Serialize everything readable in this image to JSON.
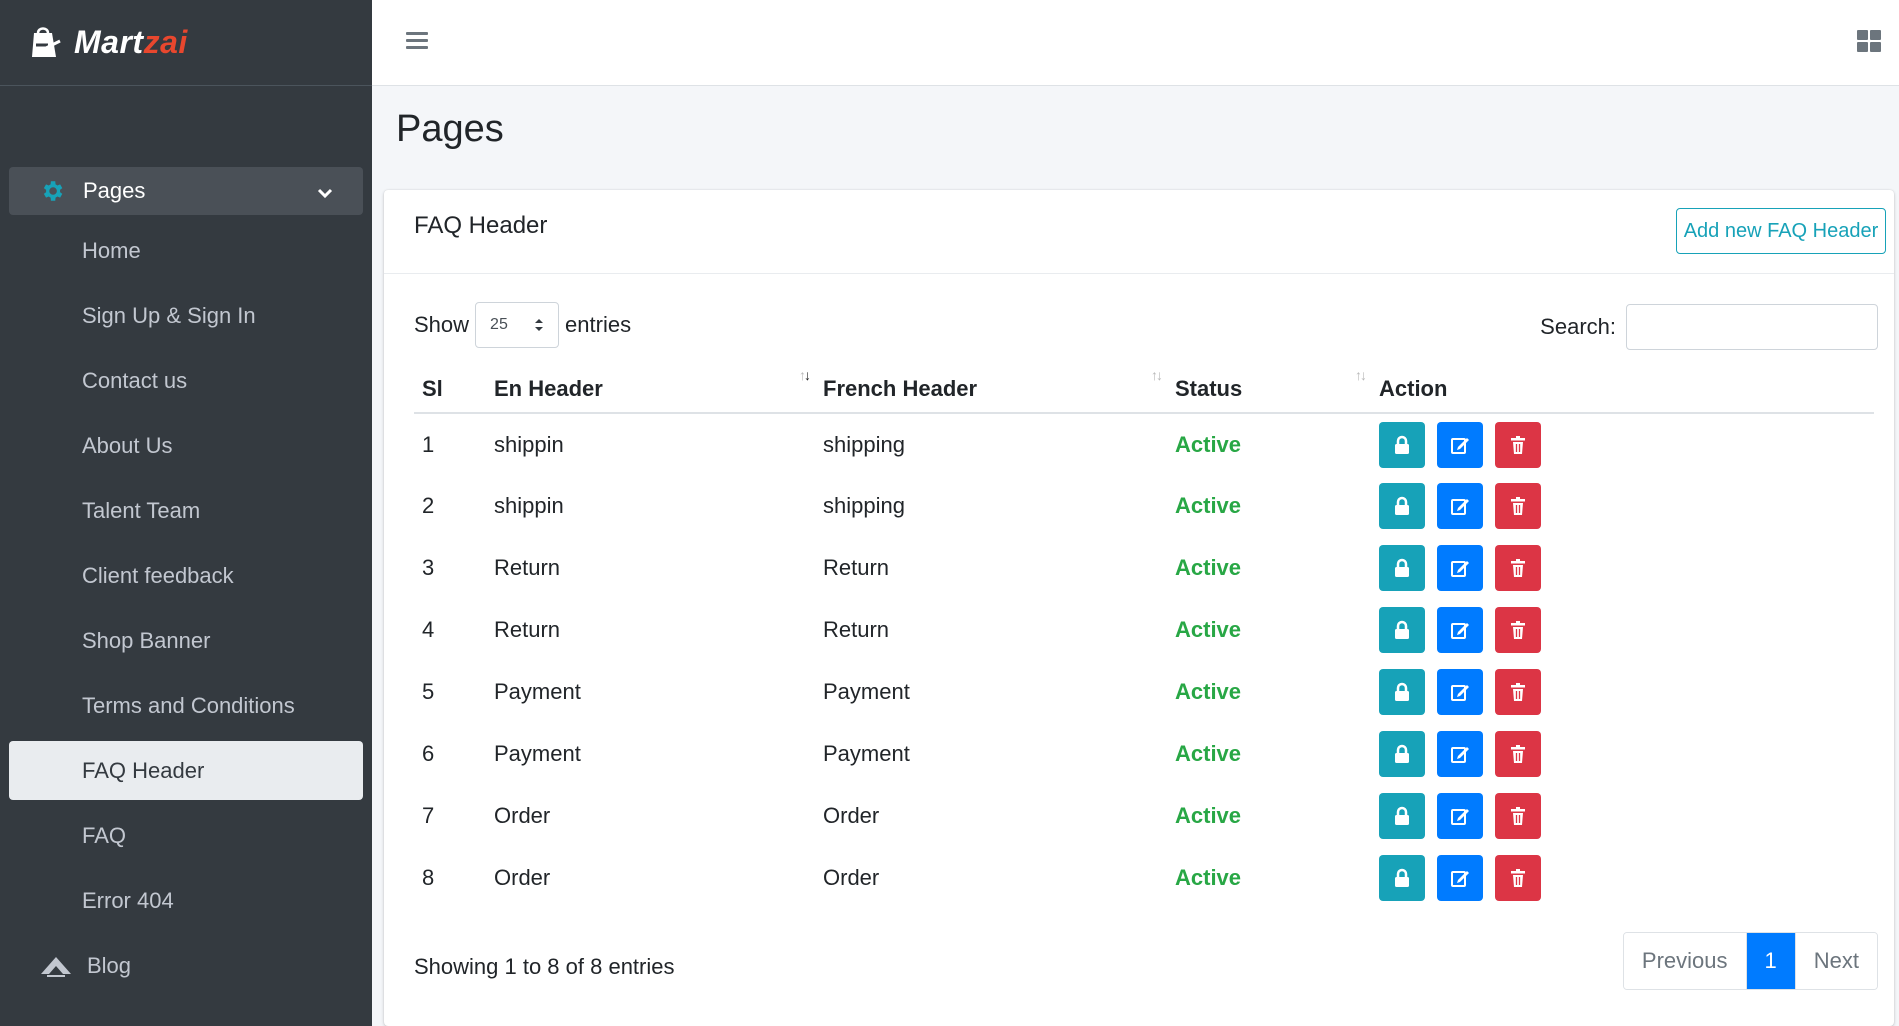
{
  "brand": {
    "name_part1": "Mart",
    "name_part2": "zai"
  },
  "sidebar": {
    "parent": {
      "label": "Pages"
    },
    "items": [
      {
        "label": "Home"
      },
      {
        "label": "Sign Up & Sign In"
      },
      {
        "label": "Contact us"
      },
      {
        "label": "About Us"
      },
      {
        "label": "Talent Team"
      },
      {
        "label": "Client feedback"
      },
      {
        "label": "Shop Banner"
      },
      {
        "label": "Terms and Conditions"
      },
      {
        "label": "FAQ Header"
      },
      {
        "label": "FAQ"
      },
      {
        "label": "Error 404"
      }
    ],
    "blog": {
      "label": "Blog"
    }
  },
  "page": {
    "title": "Pages"
  },
  "card": {
    "title": "FAQ Header",
    "add_button": "Add new FAQ Header"
  },
  "controls": {
    "show_label": "Show",
    "entries_label": "entries",
    "length_value": "25",
    "search_label": "Search:"
  },
  "table": {
    "headers": [
      "Sl",
      "En Header",
      "French Header",
      "Status",
      "Action"
    ],
    "rows": [
      {
        "sl": "1",
        "en": "shippin",
        "fr": "shipping",
        "status": "Active"
      },
      {
        "sl": "2",
        "en": "shippin",
        "fr": "shipping",
        "status": "Active"
      },
      {
        "sl": "3",
        "en": "Return",
        "fr": "Return",
        "status": "Active"
      },
      {
        "sl": "4",
        "en": "Return",
        "fr": "Return",
        "status": "Active"
      },
      {
        "sl": "5",
        "en": "Payment",
        "fr": "Payment",
        "status": "Active"
      },
      {
        "sl": "6",
        "en": "Payment",
        "fr": "Payment",
        "status": "Active"
      },
      {
        "sl": "7",
        "en": "Order",
        "fr": "Order",
        "status": "Active"
      },
      {
        "sl": "8",
        "en": "Order",
        "fr": "Order",
        "status": "Active"
      }
    ]
  },
  "footer": {
    "info": "Showing 1 to 8 of 8 entries",
    "previous": "Previous",
    "current_page": "1",
    "next": "Next"
  },
  "colors": {
    "sidebar_bg": "#343a40",
    "active_status": "#28a745",
    "lock_btn": "#17a2b8",
    "edit_btn": "#007bff",
    "delete_btn": "#dc3545",
    "brand_accent": "#e8472e"
  }
}
